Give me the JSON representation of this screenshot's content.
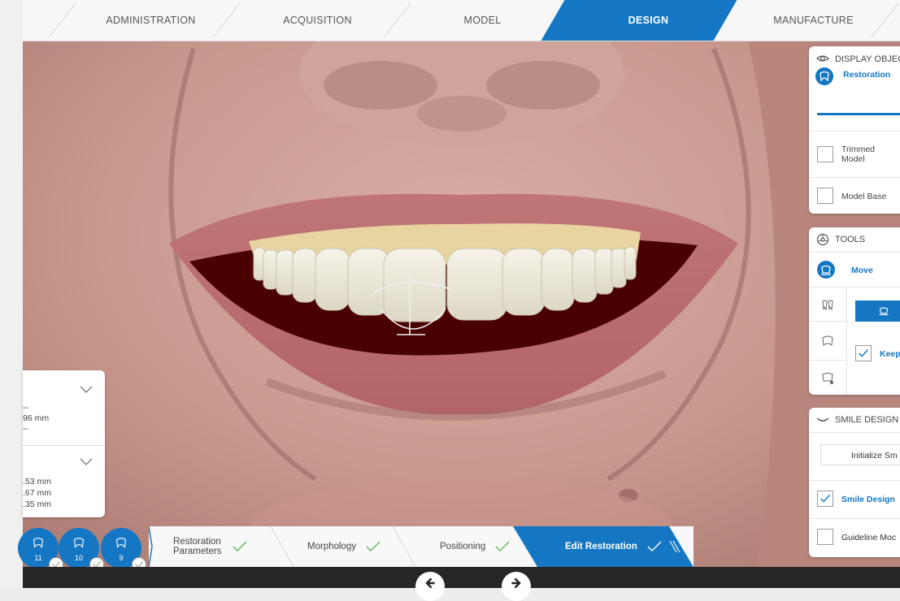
{
  "topnav": {
    "steps": [
      {
        "label": "ADMINISTRATION"
      },
      {
        "label": "ACQUISITION"
      },
      {
        "label": "MODEL"
      },
      {
        "label": "DESIGN"
      },
      {
        "label": "MANUFACTURE"
      }
    ],
    "active_index": 3
  },
  "display_objects": {
    "title": "DISPLAY OBJEC",
    "restoration_label": "Restoration",
    "items": [
      {
        "label_line1": "Trimmed",
        "label_line2": "Model",
        "checked": false
      },
      {
        "label": "Model Base",
        "checked": false
      }
    ]
  },
  "tools": {
    "title": "TOOLS",
    "move_label": "Move",
    "keep_label": "Keep",
    "keep_checked": true
  },
  "smile_design": {
    "title": "SMILE DESIGN",
    "init_button": "Initialize Sm",
    "smile_design_label": "Smile Design",
    "smile_design_checked": true,
    "guideline_label": "Guideline Moc",
    "guideline_checked": false
  },
  "left_panel": {
    "section1": {
      "line1": "--",
      "line2": "96 mm",
      "line3": "--"
    },
    "section2": {
      "line1": ".53 mm",
      "line2": ".67 mm",
      "line3": ".35 mm"
    }
  },
  "teeth": [
    {
      "number": "11"
    },
    {
      "number": "10"
    },
    {
      "number": "9"
    }
  ],
  "wizard": {
    "steps": [
      {
        "label_line1": "Restoration",
        "label_line2": "Parameters",
        "done": true
      },
      {
        "label": "Morphology",
        "done": true
      },
      {
        "label": "Positioning",
        "done": true
      },
      {
        "label": "Edit Restoration",
        "done": true,
        "active": true
      }
    ]
  },
  "colors": {
    "accent": "#1577c3",
    "mouth": "#4a0000",
    "teeth": "#eeeadb",
    "gum": "#e8d4a0",
    "bottom_bar": "#262626"
  }
}
